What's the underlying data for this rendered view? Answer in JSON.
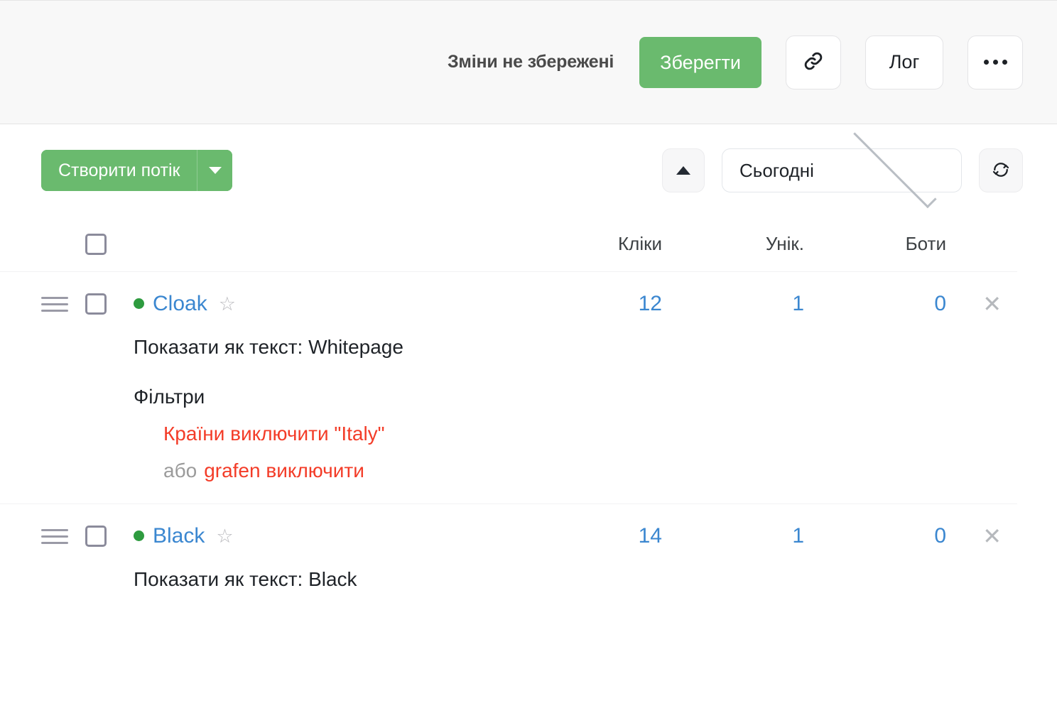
{
  "header": {
    "unsaved_label": "Зміни не збережені",
    "save_label": "Зберегти",
    "link_icon": "link-icon",
    "log_label": "Лог",
    "more_icon": "ellipsis-icon"
  },
  "toolbar": {
    "create_label": "Створити потік",
    "create_caret_icon": "chevron-down-icon",
    "collapse_icon": "chevron-up-icon",
    "date_filter": {
      "value": "Сьогодні",
      "chevron_icon": "chevron-down-icon"
    },
    "refresh_icon": "refresh-icon"
  },
  "table": {
    "columns": [
      "Кліки",
      "Унік.",
      "Боти"
    ],
    "rows": [
      {
        "name": "Cloak",
        "status": "active",
        "clicks": "12",
        "unique": "1",
        "bots": "0",
        "subtitle": "Показати як текст: Whitepage",
        "filters_label": "Фільтри",
        "filters": [
          {
            "or": "",
            "text": "Країни виключити \"Italy\""
          },
          {
            "or": "або",
            "text": "grafen виключити"
          }
        ]
      },
      {
        "name": "Black",
        "status": "active",
        "clicks": "14",
        "unique": "1",
        "bots": "0",
        "subtitle": "Показати як текст: Black",
        "filters_label": "",
        "filters": []
      }
    ]
  },
  "colors": {
    "brand_green": "#6aba6e",
    "link_blue": "#3b87d0",
    "status_green": "#2e9b3f",
    "filter_red": "#f33c28",
    "topbar_bg": "#f8f8f8"
  }
}
